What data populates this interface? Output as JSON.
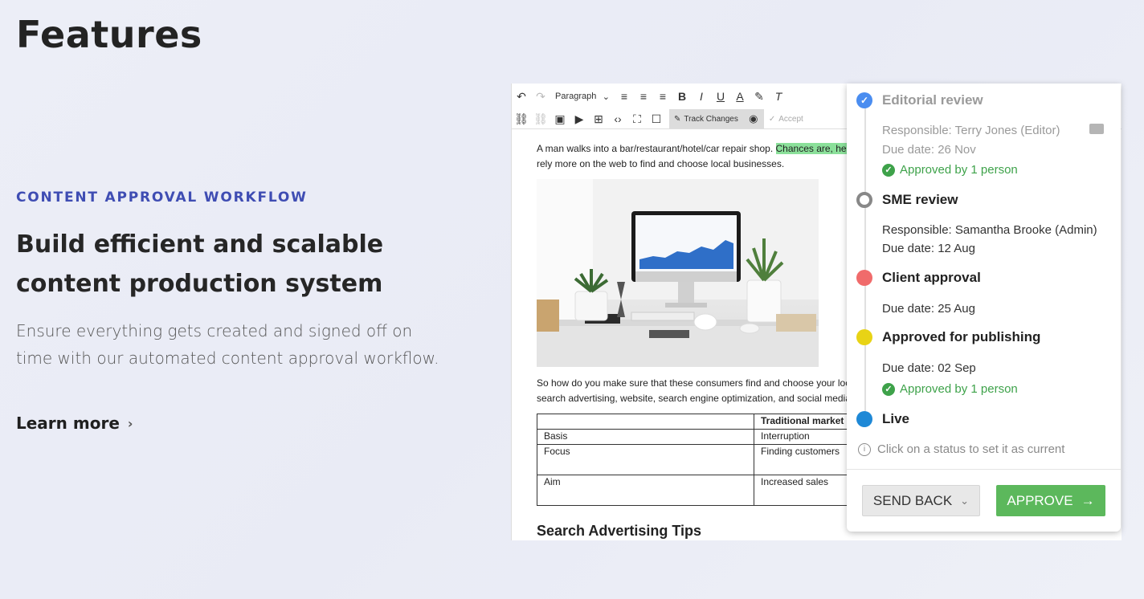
{
  "page": {
    "title": "Features",
    "eyebrow": "CONTENT APPROVAL WORKFLOW",
    "headline": "Build efficient and scalable content production system",
    "description": "Ensure everything gets created and signed off on time with our automated content approval workflow.",
    "learn_more": "Learn more"
  },
  "editor": {
    "toolbar": {
      "paragraph": "Paragraph",
      "track_changes": "Track Changes",
      "accept": "Accept"
    },
    "intro_plain": "A man walks into a bar/restaurant/hotel/car repair shop. ",
    "intro_highlight": "Chances are, he",
    "intro_line2": "rely more on the web to find and choose local businesses.",
    "para2_line1": "So how do you make sure that these consumers find and choose your loc",
    "para2_line2": "search advertising, website, search engine optimization, and social media",
    "table": {
      "header": [
        "",
        "Traditional market"
      ],
      "rows": [
        [
          "Basis",
          "Interruption"
        ],
        [
          "Focus",
          "Finding customers"
        ],
        [
          "Aim",
          "Increased sales"
        ]
      ]
    },
    "heading": "Search Advertising Tips"
  },
  "workflow": {
    "statuses": [
      {
        "name": "Editorial review",
        "color": "#4a8df0",
        "responsible": "Responsible: Terry Jones (Editor)",
        "due": "Due date: 26 Nov",
        "approved": "Approved by 1 person"
      },
      {
        "name": "SME review",
        "color": "#888888",
        "responsible": "Responsible: Samantha Brooke (Admin)",
        "due": "Due date: 12 Aug"
      },
      {
        "name": "Client approval",
        "color": "#f06b6b",
        "due": "Due date: 25 Aug"
      },
      {
        "name": "Approved for publishing",
        "color": "#e8d315",
        "due": "Due date: 02 Sep",
        "approved": "Approved by 1 person"
      },
      {
        "name": "Live",
        "color": "#1e88d6"
      }
    ],
    "hint": "Click on a status to set it as current",
    "send_back": "SEND BACK",
    "approve": "APPROVE"
  }
}
